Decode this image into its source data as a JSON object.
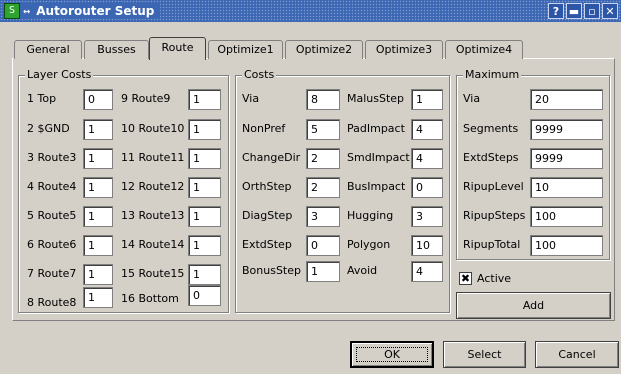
{
  "window": {
    "title": "Autorouter Setup",
    "app_icon": "S",
    "app_icon2": "↔",
    "buttons": [
      "?",
      "▬",
      "▫",
      "✕"
    ]
  },
  "tabs": [
    "General",
    "Busses",
    "Route",
    "Optimize1",
    "Optimize2",
    "Optimize3",
    "Optimize4"
  ],
  "active_tab": "Route",
  "layer_costs": {
    "title": "Layer Costs",
    "left": [
      {
        "label": "1 Top",
        "value": "0"
      },
      {
        "label": "2 $GND",
        "value": "1"
      },
      {
        "label": "3 Route3",
        "value": "1"
      },
      {
        "label": "4 Route4",
        "value": "1"
      },
      {
        "label": "5 Route5",
        "value": "1"
      },
      {
        "label": "6 Route6",
        "value": "1"
      },
      {
        "label": "7 Route7",
        "value": "1"
      },
      {
        "label": "8 Route8",
        "value": "1"
      }
    ],
    "right": [
      {
        "label": "9 Route9",
        "value": "1"
      },
      {
        "label": "10 Route10",
        "value": "1"
      },
      {
        "label": "11 Route11",
        "value": "1"
      },
      {
        "label": "12 Route12",
        "value": "1"
      },
      {
        "label": "13 Route13",
        "value": "1"
      },
      {
        "label": "14 Route14",
        "value": "1"
      },
      {
        "label": "15 Route15",
        "value": "1"
      },
      {
        "label": "16 Bottom",
        "value": "0"
      }
    ]
  },
  "costs": {
    "title": "Costs",
    "left": [
      {
        "label": "Via",
        "value": "8"
      },
      {
        "label": "NonPref",
        "value": "5"
      },
      {
        "label": "ChangeDir",
        "value": "2"
      },
      {
        "label": "OrthStep",
        "value": "2"
      },
      {
        "label": "DiagStep",
        "value": "3"
      },
      {
        "label": "ExtdStep",
        "value": "0"
      },
      {
        "label": "BonusStep",
        "value": "1"
      }
    ],
    "right": [
      {
        "label": "MalusStep",
        "value": "1"
      },
      {
        "label": "PadImpact",
        "value": "4"
      },
      {
        "label": "SmdImpact",
        "value": "4"
      },
      {
        "label": "BusImpact",
        "value": "0"
      },
      {
        "label": "Hugging",
        "value": "3"
      },
      {
        "label": "Polygon",
        "value": "10"
      },
      {
        "label": "Avoid",
        "value": "4"
      }
    ]
  },
  "maximum": {
    "title": "Maximum",
    "rows": [
      {
        "label": "Via",
        "value": "20"
      },
      {
        "label": "Segments",
        "value": "9999"
      },
      {
        "label": "ExtdSteps",
        "value": "9999"
      },
      {
        "label": "RipupLevel",
        "value": "10"
      },
      {
        "label": "RipupSteps",
        "value": "100"
      },
      {
        "label": "RipupTotal",
        "value": "100"
      }
    ]
  },
  "active": {
    "label": "Active",
    "checked": true,
    "mark": "✖"
  },
  "add_label": "Add",
  "footer": {
    "ok": "OK",
    "select": "Select",
    "cancel": "Cancel"
  }
}
